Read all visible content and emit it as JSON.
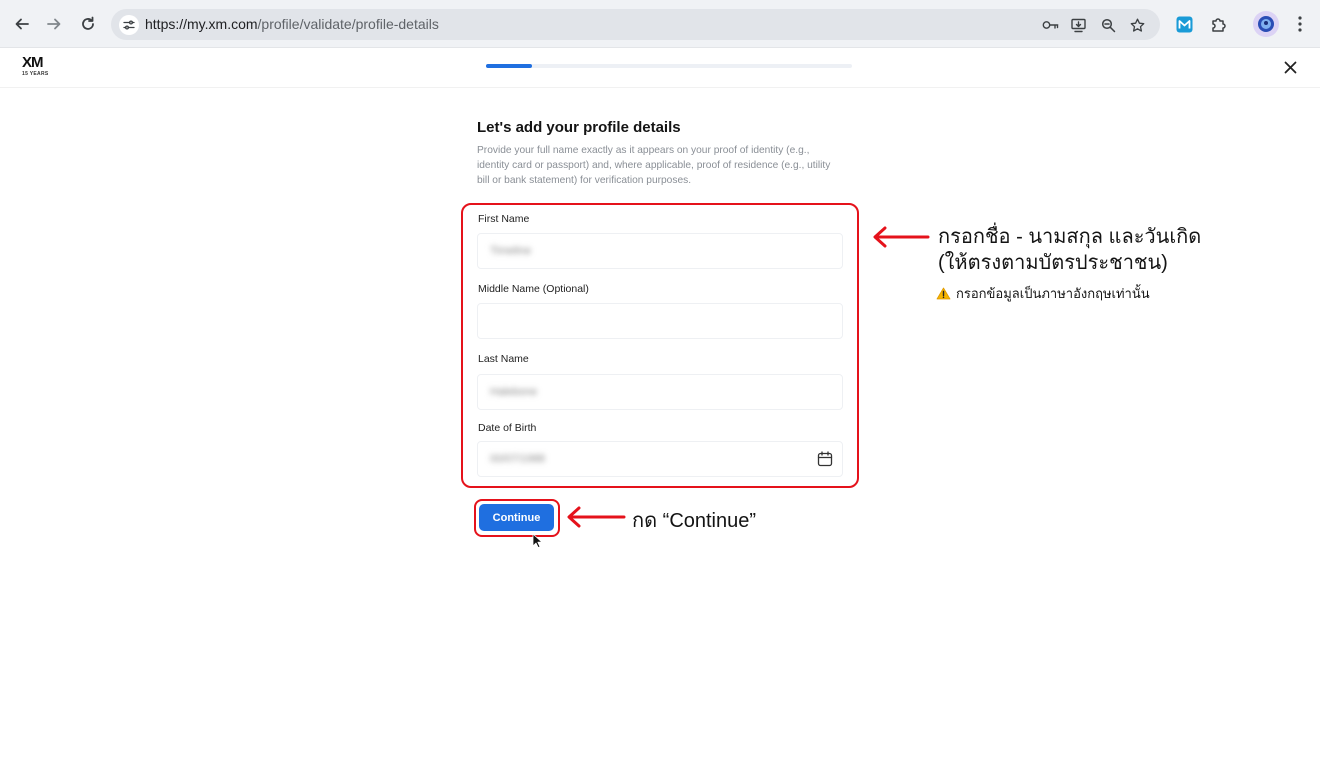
{
  "browser": {
    "url_host": "https://my.xm.com",
    "url_path": "/profile/validate/profile-details"
  },
  "header": {
    "logo_text": "XM",
    "logo_sub": "15 YEARS",
    "progress_fraction": 0.125
  },
  "form": {
    "title": "Let's add your profile details",
    "description": "Provide your full name exactly as it appears on your proof of identity (e.g., identity card or passport) and, where applicable, proof of residence (e.g., utility bill or bank statement) for verification purposes.",
    "fields": [
      {
        "label": "First Name",
        "value": "Timeline"
      },
      {
        "label": "Middle Name (Optional)",
        "value": ""
      },
      {
        "label": "Last Name",
        "value": "Halebone"
      },
      {
        "label": "Date of Birth",
        "value": "00/07/1988"
      }
    ],
    "continue_label": "Continue"
  },
  "annotations": {
    "fill_line1": "กรอกชื่อ - นามสกุล และวันเกิด",
    "fill_line2": "(ให้ตรงตามบัตรประชาชน)",
    "warning": "กรอกข้อมูลเป็นภาษาอังกฤษเท่านั้น",
    "press_continue": "กด “Continue”",
    "annotation_color": "#e5121b",
    "accent_color": "#1f6fe0"
  }
}
